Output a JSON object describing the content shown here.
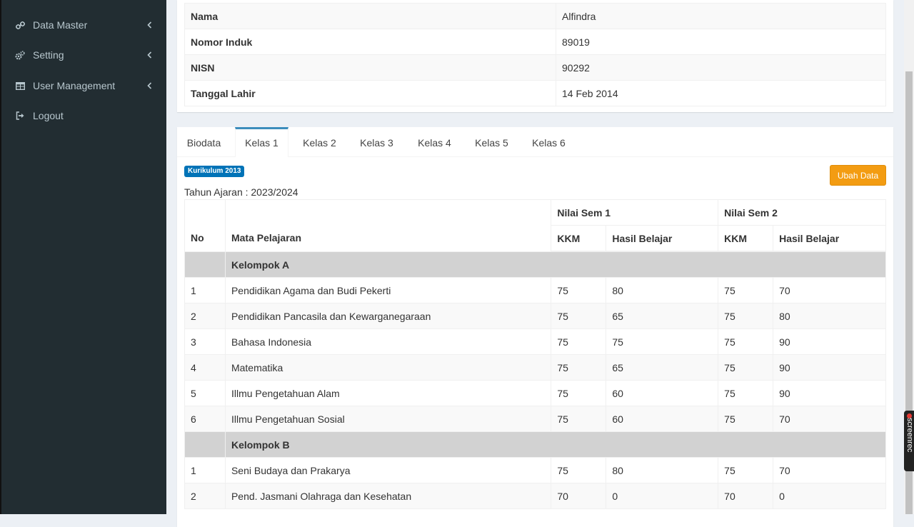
{
  "sidebar": {
    "items": [
      {
        "label": "Data Master",
        "icon": "link-icon",
        "has_chevron": true
      },
      {
        "label": "Setting",
        "icon": "gears-icon",
        "has_chevron": true
      },
      {
        "label": "User Management",
        "icon": "table-icon",
        "has_chevron": true
      },
      {
        "label": "Logout",
        "icon": "sign-out-icon",
        "has_chevron": false
      }
    ]
  },
  "student": {
    "rows": [
      {
        "label": "Nama",
        "value": "Alfindra"
      },
      {
        "label": "Nomor Induk",
        "value": "89019"
      },
      {
        "label": "NISN",
        "value": "90292"
      },
      {
        "label": "Tanggal Lahir",
        "value": "14 Feb 2014"
      }
    ]
  },
  "tabs": [
    "Biodata",
    "Kelas 1",
    "Kelas 2",
    "Kelas 3",
    "Kelas 4",
    "Kelas 5",
    "Kelas 6"
  ],
  "active_tab": "Kelas 1",
  "curriculum_badge": "Kurikulum 2013",
  "edit_button": "Ubah Data",
  "academic_year": "Tahun Ajaran : 2023/2024",
  "grades": {
    "headers": {
      "no": "No",
      "subject": "Mata Pelajaran",
      "sem1": "Nilai Sem 1",
      "sem2": "Nilai Sem 2",
      "kkm": "KKM",
      "result": "Hasil Belajar"
    },
    "groups": [
      {
        "name": "Kelompok A",
        "rows": [
          {
            "no": "1",
            "subject": "Pendidikan Agama dan Budi Pekerti",
            "kkm1": "75",
            "hasil1": "80",
            "kkm2": "75",
            "hasil2": "70"
          },
          {
            "no": "2",
            "subject": "Pendidikan Pancasila dan Kewarganegaraan",
            "kkm1": "75",
            "hasil1": "65",
            "kkm2": "75",
            "hasil2": "80"
          },
          {
            "no": "3",
            "subject": "Bahasa Indonesia",
            "kkm1": "75",
            "hasil1": "75",
            "kkm2": "75",
            "hasil2": "90"
          },
          {
            "no": "4",
            "subject": "Matematika",
            "kkm1": "75",
            "hasil1": "65",
            "kkm2": "75",
            "hasil2": "90"
          },
          {
            "no": "5",
            "subject": "Illmu Pengetahuan Alam",
            "kkm1": "75",
            "hasil1": "60",
            "kkm2": "75",
            "hasil2": "90"
          },
          {
            "no": "6",
            "subject": "Illmu Pengetahuan Sosial",
            "kkm1": "75",
            "hasil1": "60",
            "kkm2": "75",
            "hasil2": "70"
          }
        ]
      },
      {
        "name": "Kelompok B",
        "rows": [
          {
            "no": "1",
            "subject": "Seni Budaya dan Prakarya",
            "kkm1": "75",
            "hasil1": "80",
            "kkm2": "75",
            "hasil2": "70"
          },
          {
            "no": "2",
            "subject": "Pend. Jasmani Olahraga dan Kesehatan",
            "kkm1": "70",
            "hasil1": "0",
            "kkm2": "70",
            "hasil2": "0"
          }
        ]
      }
    ]
  },
  "watermark": "screenrec"
}
